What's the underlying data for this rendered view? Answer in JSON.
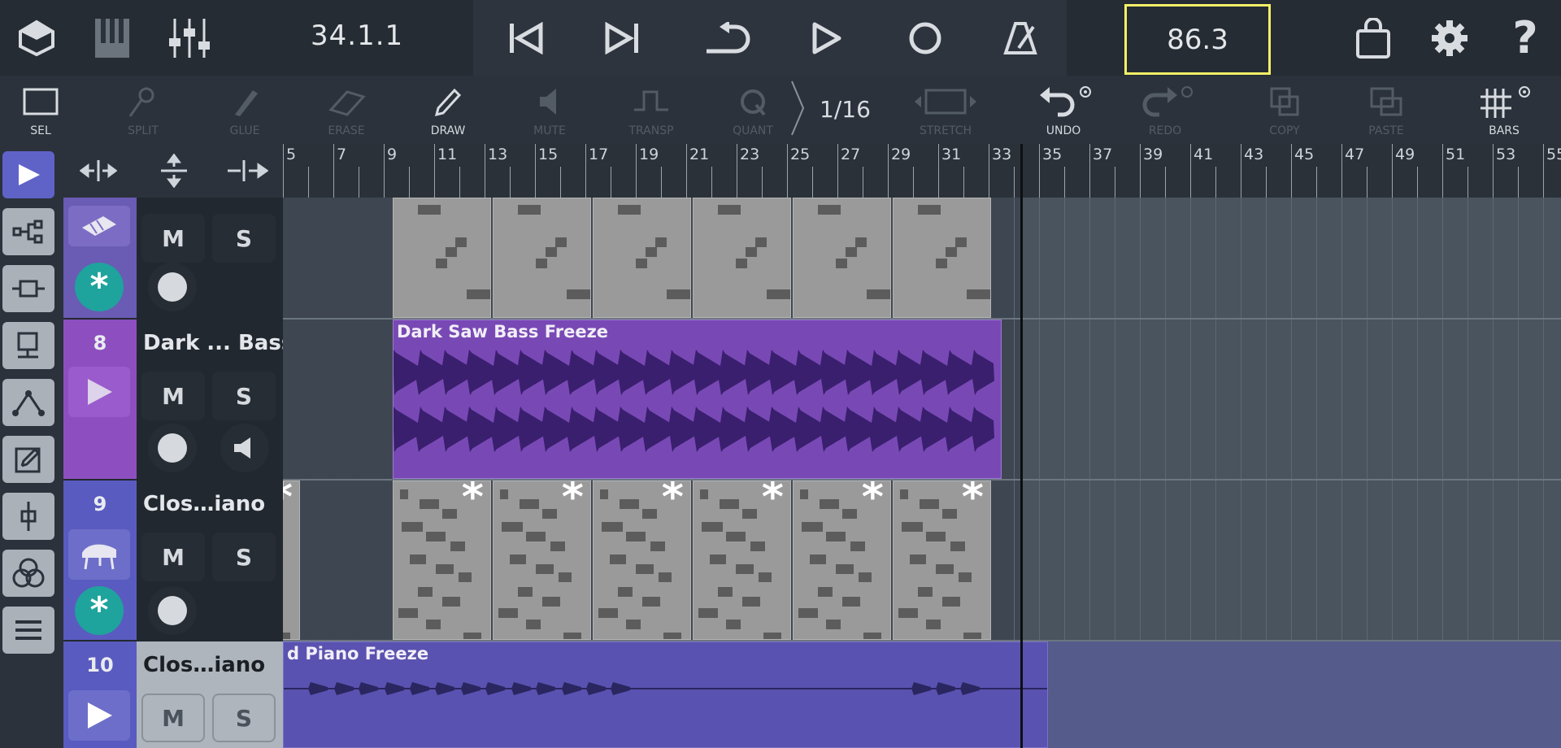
{
  "topbar": {
    "position": "34.1.1",
    "tempo": "86.3",
    "buttons": [
      "app-icon",
      "keyboard-icon",
      "mixer-icon",
      "skip-back-icon",
      "skip-forward-icon",
      "loop-icon",
      "play-icon",
      "record-icon",
      "metronome-icon",
      "shop-icon",
      "settings-icon",
      "help-icon"
    ]
  },
  "toolbar": {
    "tools": [
      {
        "label": "SEL",
        "icon": "select-icon",
        "enabled": true
      },
      {
        "label": "SPLIT",
        "icon": "split-icon",
        "enabled": false
      },
      {
        "label": "GLUE",
        "icon": "glue-icon",
        "enabled": false
      },
      {
        "label": "ERASE",
        "icon": "erase-icon",
        "enabled": false
      },
      {
        "label": "DRAW",
        "icon": "draw-icon",
        "enabled": true
      },
      {
        "label": "MUTE",
        "icon": "mute-icon",
        "enabled": false
      },
      {
        "label": "TRANSP",
        "icon": "transpose-icon",
        "enabled": false
      },
      {
        "label": "QUANT",
        "icon": "quantize-icon",
        "enabled": false
      },
      {
        "label": "STRETCH",
        "icon": "stretch-icon",
        "enabled": false
      },
      {
        "label": "UNDO",
        "icon": "undo-icon",
        "enabled": true
      },
      {
        "label": "REDO",
        "icon": "redo-icon",
        "enabled": false
      },
      {
        "label": "COPY",
        "icon": "copy-icon",
        "enabled": false
      },
      {
        "label": "PASTE",
        "icon": "paste-icon",
        "enabled": false
      },
      {
        "label": "BARS",
        "icon": "bars-grid-icon",
        "enabled": true
      }
    ],
    "quantize_value": "1/16"
  },
  "sidebar": {
    "items": [
      "play-arrow-icon",
      "routing-icon",
      "insert-icon",
      "monitor-icon",
      "automation-icon",
      "edit-icon",
      "fader-icon",
      "circles-icon",
      "menu-icon"
    ]
  },
  "track_tools": [
    "horizontal-zoom-icon",
    "vertical-zoom-icon",
    "split-track-icon"
  ],
  "tracks": [
    {
      "number": "",
      "name": "",
      "instrument": "keyboard-instrument-icon",
      "mute": "M",
      "solo": "S",
      "color": "#6a5bb4"
    },
    {
      "number": "8",
      "name": "Dark ... Bass",
      "instrument": "play-triangle-icon",
      "mute": "M",
      "solo": "S",
      "color": "#8d4fc0"
    },
    {
      "number": "9",
      "name": "Clos…iano",
      "instrument": "piano-icon",
      "mute": "M",
      "solo": "S",
      "color": "#5a5bc0"
    },
    {
      "number": "10",
      "name": "Clos…iano",
      "instrument": "play-triangle-icon",
      "mute": "M",
      "solo": "S",
      "color": "#5a5bc0"
    }
  ],
  "ruler": {
    "bars": [
      "5",
      "7",
      "9",
      "11",
      "13",
      "15",
      "17",
      "19",
      "21",
      "23",
      "25",
      "27",
      "29",
      "31",
      "33",
      "35",
      "37",
      "39",
      "41",
      "43",
      "45",
      "47",
      "49",
      "51",
      "53",
      "55"
    ]
  },
  "clips": {
    "bass": "Dark Saw Bass Freeze",
    "piano": "d Piano Freeze"
  },
  "colors": {
    "accent": "#5f63c8",
    "bass_clip": "#7849b4",
    "piano_clip": "#5a52b0",
    "midi_clip": "#9a9a9a",
    "tempo_highlight": "#f5f067"
  }
}
